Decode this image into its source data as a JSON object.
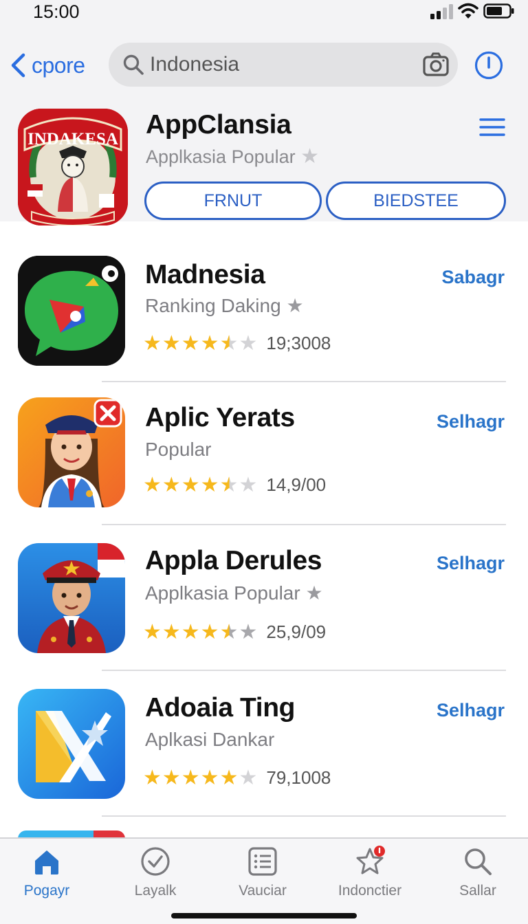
{
  "status_bar": {
    "time": "15:00"
  },
  "nav": {
    "back_label": "cpore",
    "search_value": "Indonesia"
  },
  "featured": {
    "icon_banner_text": "INDAKESA",
    "title": "AppClansia",
    "subtitle": "Applkasia Popular",
    "button_primary": "FRNUT",
    "button_secondary": "BIEDSTEE"
  },
  "apps": [
    {
      "title": "Madnesia",
      "subtitle": "Ranking Daking",
      "subtitle_star": true,
      "rating": 4.5,
      "count": "19;3008",
      "action": "Sabagr"
    },
    {
      "title": "Aplic Yerats",
      "subtitle": "Popular",
      "subtitle_star": false,
      "rating": 4.5,
      "count": "14,9/00",
      "action": "Selhagr"
    },
    {
      "title": "Appla Derules",
      "subtitle": "Applkasia Popular",
      "subtitle_star": true,
      "rating": 4.5,
      "count": "25,9/09",
      "action": "Selhagr"
    },
    {
      "title": "Adoaia Ting",
      "subtitle": "Aplkasi Dankar",
      "subtitle_star": false,
      "rating": 5,
      "count": "79,1008",
      "action": "Selhagr"
    }
  ],
  "tabs": [
    {
      "label": "Pogayr",
      "icon": "home-icon",
      "active": true
    },
    {
      "label": "Layalk",
      "icon": "check-circle-icon",
      "active": false
    },
    {
      "label": "Vauciar",
      "icon": "list-icon",
      "active": false
    },
    {
      "label": "Indonctier",
      "icon": "star-badge-icon",
      "active": false
    },
    {
      "label": "Sallar",
      "icon": "search-icon",
      "active": false
    }
  ],
  "colors": {
    "accent": "#2a74c9",
    "star_gold": "#f6b81c",
    "star_gray": "#d3d3d6",
    "badge_red": "#e02a2a"
  }
}
